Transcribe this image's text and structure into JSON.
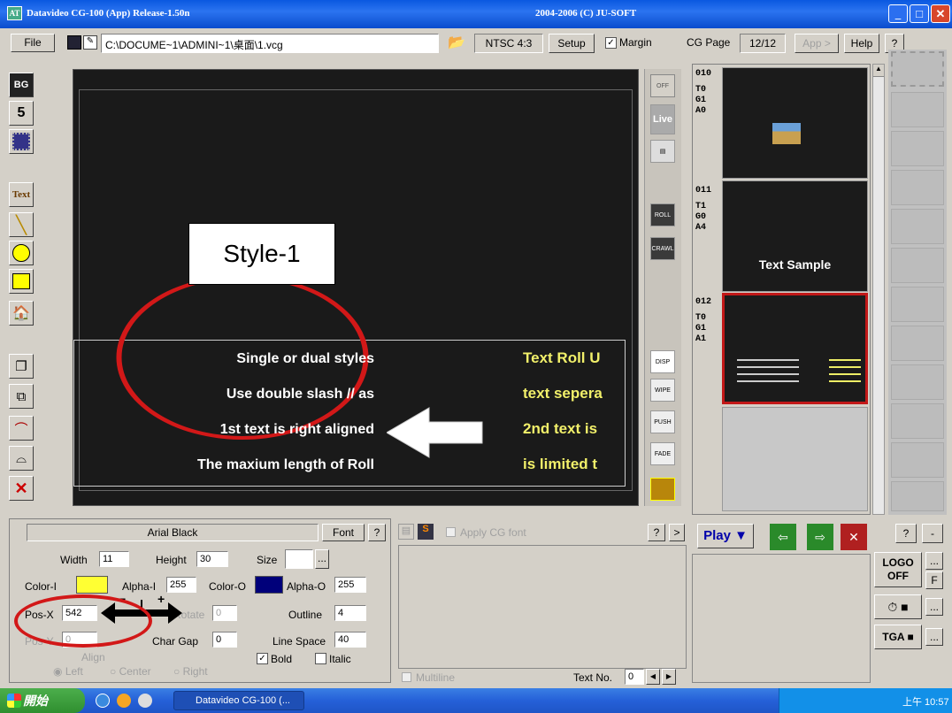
{
  "window": {
    "title": "Datavideo CG-100  (App)  Release-1.50n",
    "copyright": "2004-2006 (C) JU-SOFT"
  },
  "toolbar": {
    "file_label": "File",
    "path": "C:\\DOCUME~1\\ADMINI~1\\桌面\\1.vcg",
    "format": "NTSC 4:3",
    "setup_label": "Setup",
    "margin_label": "Margin",
    "cg_page_label": "CG Page",
    "cg_page_value": "12/12",
    "app_label": "App >",
    "help_label": "Help",
    "question_label": "?"
  },
  "left_tools": {
    "bg": "BG",
    "five": "5",
    "text": "Text"
  },
  "canvas": {
    "style_label": "Style-1",
    "left_lines": [
      "Single or dual styles",
      "Use double slash // as",
      "1st text is right aligned",
      "The maxium length of Roll"
    ],
    "right_lines": [
      "Text Roll U",
      "text sepera",
      "2nd text is",
      "is limited t"
    ]
  },
  "right_tools": {
    "off": "OFF",
    "live": "Live",
    "roll": "ROLL",
    "crawl": "CRAWL",
    "disp": "DISP",
    "wipe": "WIPE",
    "push": "PUSH",
    "fade": "FADE"
  },
  "pages": [
    {
      "id": "010",
      "lines": [
        "T0",
        "G1",
        "A0"
      ],
      "content": ""
    },
    {
      "id": "011",
      "lines": [
        "T1",
        "G0",
        "A4"
      ],
      "content": "Text Sample"
    },
    {
      "id": "012",
      "lines": [
        "T0",
        "G1",
        "A1"
      ],
      "content": ""
    }
  ],
  "props": {
    "font_name": "Arial Black",
    "font_button": "Font",
    "q": "?",
    "width_label": "Width",
    "width_value": "11",
    "height_label": "Height",
    "height_value": "30",
    "size_label": "Size",
    "size_btn": "...",
    "color_i_label": "Color-I",
    "alpha_i_label": "Alpha-I",
    "alpha_i_value": "255",
    "color_o_label": "Color-O",
    "alpha_o_label": "Alpha-O",
    "alpha_o_value": "255",
    "posx_label": "Pos-X",
    "posx_value": "542",
    "rotate_label": "Rotate",
    "rotate_value": "0",
    "outline_label": "Outline",
    "outline_value": "4",
    "posy_label": "Pos-Y",
    "posy_value": "0",
    "chargap_label": "Char Gap",
    "chargap_value": "0",
    "linespace_label": "Line Space",
    "linespace_value": "40",
    "align_label": "Align",
    "left_label": "Left",
    "center_label": "Center",
    "right_label": "Right",
    "bold_label": "Bold",
    "italic_label": "Italic",
    "color_i": "#ffff33",
    "color_o": "#00007a"
  },
  "middle": {
    "apply_cg_font": "Apply CG font",
    "q": "?",
    "arrow": ">",
    "multiline": "Multiline",
    "textno_label": "Text No.",
    "textno_value": "0"
  },
  "playpanel": {
    "play_label": "Play"
  },
  "rightpanel": {
    "q": "?",
    "minus": "-",
    "logo": "LOGO",
    "logo_state": "OFF",
    "f": "F",
    "dots": "...",
    "tga": "TGA"
  },
  "taskbar": {
    "start_label": "開始",
    "task_label": "Datavideo CG-100 (...",
    "time": "上午 10:57"
  }
}
